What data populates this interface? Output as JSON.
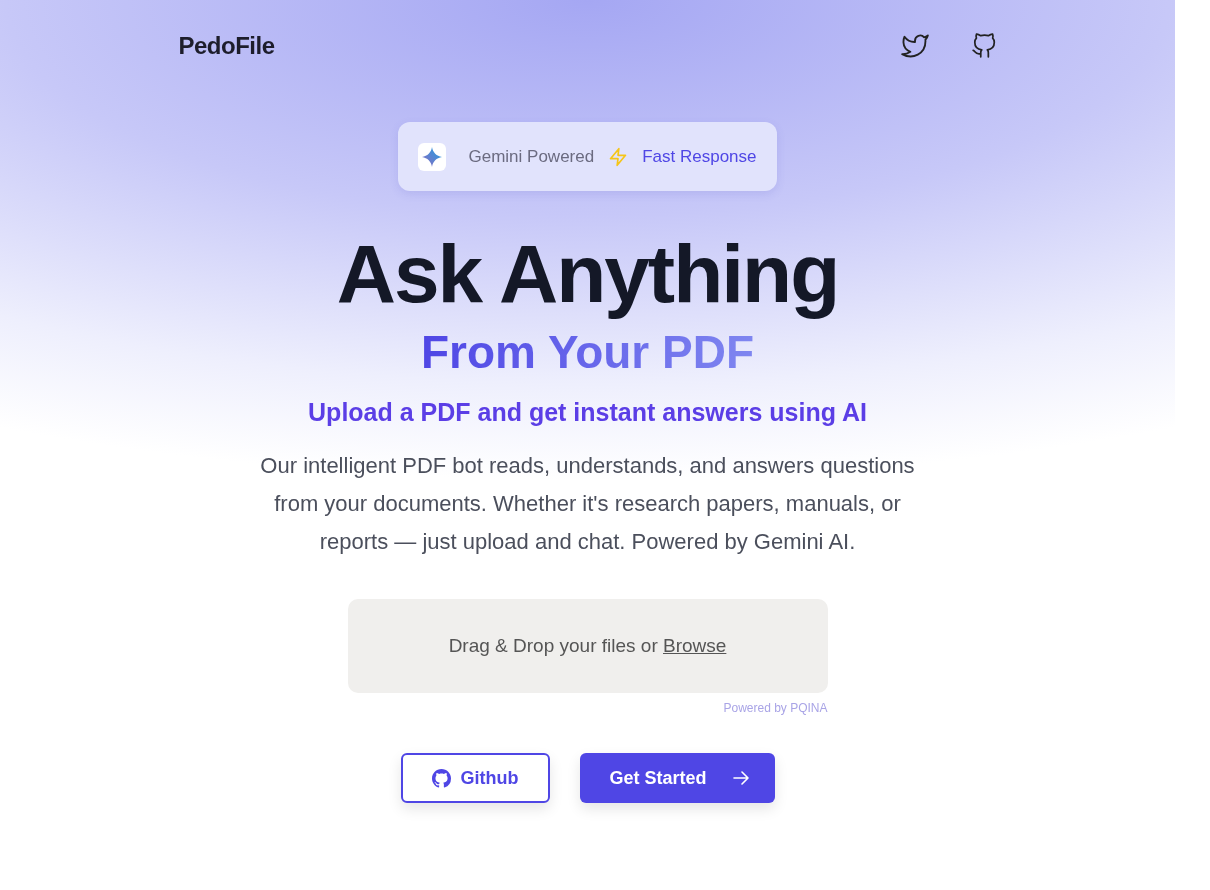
{
  "nav": {
    "brand": "PedoFile"
  },
  "badge": {
    "items": [
      "Gemini Powered",
      "Fast Response"
    ]
  },
  "hero": {
    "title": "Ask Anything",
    "subtitle": "From Your PDF",
    "tagline": "Upload a PDF and get instant answers using AI",
    "description": "Our intelligent PDF bot reads, understands, and answers questions from your documents. Whether it's research papers, manuals, or reports — just upload and chat. Powered by Gemini AI."
  },
  "dropzone": {
    "text": "Drag & Drop your files or",
    "link": "Browse",
    "credit": "Powered by PQINA"
  },
  "buttons": [
    {
      "kind": "outline",
      "label": "Github"
    },
    {
      "kind": "primary",
      "label": "Get Started"
    }
  ]
}
